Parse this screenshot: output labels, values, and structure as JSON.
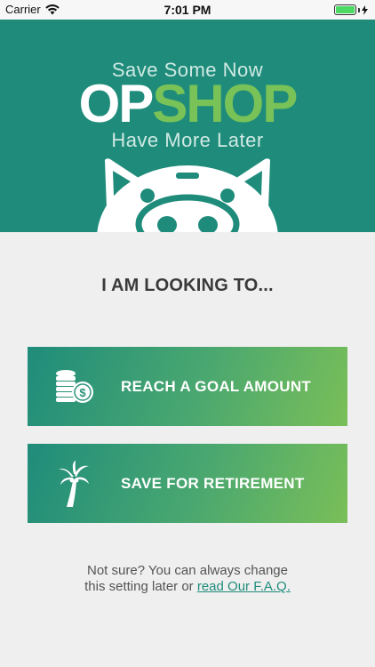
{
  "status_bar": {
    "carrier": "Carrier",
    "time": "7:01 PM",
    "battery_level": 1.0
  },
  "hero": {
    "tagline_top": "Save Some Now",
    "logo_part1": "OP",
    "logo_part2": "SHOP",
    "tagline_bottom": "Have More Later",
    "colors": {
      "background": "#1f8c7b",
      "logo_accent": "#78c257"
    }
  },
  "main": {
    "prompt": "I AM LOOKING TO...",
    "options": [
      {
        "label": "REACH A GOAL AMOUNT",
        "icon": "coins-icon"
      },
      {
        "label": "SAVE FOR RETIREMENT",
        "icon": "palm-tree-icon"
      }
    ]
  },
  "footer": {
    "note_line1": "Not sure? You can always change",
    "note_line2": "this setting later or",
    "faq_link": "read Our F.A.Q."
  }
}
